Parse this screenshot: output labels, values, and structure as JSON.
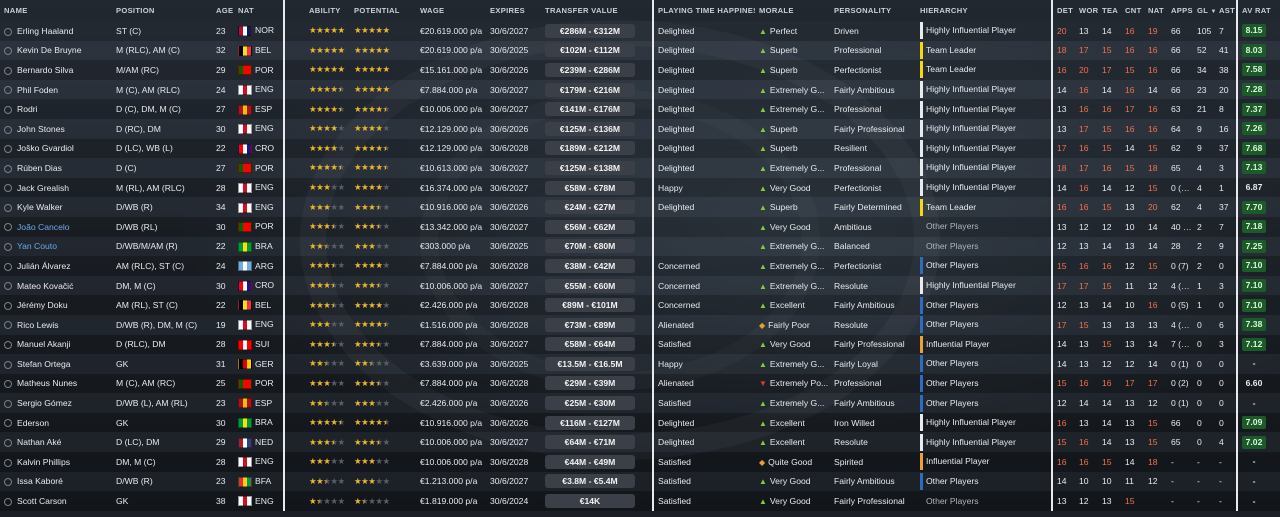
{
  "columns": {
    "name": "NAME",
    "position": "POSITION",
    "age": "AGE",
    "nat": "NAT",
    "ability": "ABILITY",
    "potential": "POTENTIAL",
    "wage": "WAGE",
    "expires": "EXPIRES",
    "transfer_value": "TRANSFER VALUE",
    "playing_time": "PLAYING TIME HAPPINESS",
    "morale": "MORALE",
    "personality": "PERSONALITY",
    "hierarchy": "HIERARCHY",
    "det": "DET",
    "wor": "WOR",
    "tea": "TEA",
    "cnt": "CNT",
    "nat2": "NAT",
    "apps": "APPS",
    "gl": "GL",
    "sort_icon": "▼",
    "ast": "AST",
    "avrat": "AV RAT"
  },
  "colors": {
    "loan_name": "#6aa8e8",
    "star": "#e9b72f",
    "hot_attr": "#f07050",
    "rating_green": "#1d5a2a"
  },
  "players": [
    {
      "name": "Erling Haaland",
      "pos": "ST (C)",
      "age": "23",
      "nat": "NOR",
      "flag": [
        "#ba0c2f",
        "#ffffff",
        "#00205b"
      ],
      "ability": 5,
      "potential": 5,
      "wage": "€20.619.000 p/a",
      "expires": "30/6/2027",
      "value": "€286M - €312M",
      "pt": "Delighted",
      "morale": "Perfect",
      "mood": "up",
      "pers": "Driven",
      "hier": "Highly Influential Player",
      "hcol": "#e8eaee",
      "det": "20",
      "wor": "13",
      "tea": "14",
      "cnt": "16",
      "nat2": "19",
      "apps": "66",
      "gl": "105",
      "ast": "7",
      "rat": "8.15",
      "rgreen": true,
      "hot": [
        1,
        0,
        0,
        1,
        1
      ]
    },
    {
      "name": "Kevin De Bruyne",
      "pos": "M (RLC), AM (C)",
      "age": "32",
      "nat": "BEL",
      "flag": [
        "#000000",
        "#fdda24",
        "#ef3340"
      ],
      "ability": 5,
      "potential": 5,
      "wage": "€20.619.000 p/a",
      "expires": "30/6/2025",
      "value": "€102M - €112M",
      "pt": "Delighted",
      "morale": "Superb",
      "mood": "up",
      "pers": "Professional",
      "hier": "Team Leader",
      "hcol": "#f5d90a",
      "det": "18",
      "wor": "17",
      "tea": "15",
      "cnt": "16",
      "nat2": "16",
      "apps": "66",
      "gl": "52",
      "ast": "41",
      "rat": "8.03",
      "rgreen": true,
      "hot": [
        1,
        1,
        1,
        1,
        1
      ]
    },
    {
      "name": "Bernardo Silva",
      "pos": "M/AM (RC)",
      "age": "29",
      "nat": "POR",
      "flag": [
        "#006600",
        "#ff0000",
        "#ff0000"
      ],
      "ability": 5,
      "potential": 5,
      "wage": "€15.161.000 p/a",
      "expires": "30/6/2026",
      "value": "€239M - €286M",
      "pt": "Delighted",
      "morale": "Superb",
      "mood": "up",
      "pers": "Perfectionist",
      "hier": "Team Leader",
      "hcol": "#f5d90a",
      "det": "16",
      "wor": "20",
      "tea": "17",
      "cnt": "15",
      "nat2": "16",
      "apps": "66",
      "gl": "34",
      "ast": "38",
      "rat": "7.58",
      "rgreen": true,
      "hot": [
        1,
        1,
        1,
        1,
        1
      ]
    },
    {
      "name": "Phil Foden",
      "pos": "M (C), AM (RLC)",
      "age": "24",
      "nat": "ENG",
      "flag": [
        "#ffffff",
        "#ce1124",
        "#ffffff"
      ],
      "ability": 4.5,
      "potential": 5,
      "wage": "€7.884.000 p/a",
      "expires": "30/6/2027",
      "value": "€179M - €216M",
      "pt": "Delighted",
      "morale": "Extremely G...",
      "mood": "up",
      "pers": "Fairly Ambitious",
      "hier": "Highly Influential Player",
      "hcol": "#e8eaee",
      "det": "14",
      "wor": "16",
      "tea": "14",
      "cnt": "16",
      "nat2": "14",
      "apps": "66",
      "gl": "23",
      "ast": "20",
      "rat": "7.28",
      "rgreen": true,
      "hot": [
        0,
        1,
        0,
        1,
        0
      ]
    },
    {
      "name": "Rodri",
      "pos": "D (C), DM, M (C)",
      "age": "27",
      "nat": "ESP",
      "flag": [
        "#aa151b",
        "#f1bf00",
        "#aa151b"
      ],
      "ability": 4.5,
      "potential": 4.5,
      "wage": "€10.006.000 p/a",
      "expires": "30/6/2027",
      "value": "€141M - €176M",
      "pt": "Delighted",
      "morale": "Extremely G...",
      "mood": "up",
      "pers": "Professional",
      "hier": "Highly Influential Player",
      "hcol": "#e8eaee",
      "det": "13",
      "wor": "16",
      "tea": "16",
      "cnt": "17",
      "nat2": "16",
      "apps": "63",
      "gl": "21",
      "ast": "8",
      "rat": "7.37",
      "rgreen": true,
      "hot": [
        0,
        1,
        1,
        1,
        1
      ]
    },
    {
      "name": "John Stones",
      "pos": "D (RC), DM",
      "age": "30",
      "nat": "ENG",
      "flag": [
        "#ffffff",
        "#ce1124",
        "#ffffff"
      ],
      "ability": 4,
      "potential": 4,
      "wage": "€12.129.000 p/a",
      "expires": "30/6/2026",
      "value": "€125M - €136M",
      "pt": "Delighted",
      "morale": "Superb",
      "mood": "up",
      "pers": "Fairly Professional",
      "hier": "Highly Influential Player",
      "hcol": "#e8eaee",
      "det": "13",
      "wor": "17",
      "tea": "15",
      "cnt": "16",
      "nat2": "16",
      "apps": "64",
      "gl": "9",
      "ast": "16",
      "rat": "7.26",
      "rgreen": true,
      "hot": [
        0,
        1,
        1,
        1,
        1
      ]
    },
    {
      "name": "Joško Gvardiol",
      "pos": "D (LC), WB (L)",
      "age": "22",
      "nat": "CRO",
      "flag": [
        "#ff0000",
        "#ffffff",
        "#171796"
      ],
      "ability": 4,
      "potential": 4.5,
      "wage": "€12.129.000 p/a",
      "expires": "30/6/2028",
      "value": "€189M - €212M",
      "pt": "Delighted",
      "morale": "Superb",
      "mood": "up",
      "pers": "Resilient",
      "hier": "Highly Influential Player",
      "hcol": "#e8eaee",
      "det": "17",
      "wor": "16",
      "tea": "15",
      "cnt": "14",
      "nat2": "15",
      "apps": "62",
      "gl": "9",
      "ast": "37",
      "rat": "7.68",
      "rgreen": true,
      "hot": [
        1,
        1,
        1,
        0,
        1
      ]
    },
    {
      "name": "Rúben Dias",
      "pos": "D (C)",
      "age": "27",
      "nat": "POR",
      "flag": [
        "#006600",
        "#ff0000",
        "#ff0000"
      ],
      "ability": 4.5,
      "potential": 4.5,
      "wage": "€10.613.000 p/a",
      "expires": "30/6/2027",
      "value": "€125M - €138M",
      "pt": "Delighted",
      "morale": "Extremely G...",
      "mood": "up",
      "pers": "Professional",
      "hier": "Highly Influential Player",
      "hcol": "#e8eaee",
      "det": "18",
      "wor": "17",
      "tea": "16",
      "cnt": "15",
      "nat2": "18",
      "apps": "65",
      "gl": "4",
      "ast": "3",
      "rat": "7.13",
      "rgreen": true,
      "hot": [
        1,
        1,
        1,
        1,
        1
      ]
    },
    {
      "name": "Jack Grealish",
      "pos": "M (RL), AM (RLC)",
      "age": "28",
      "nat": "ENG",
      "flag": [
        "#ffffff",
        "#ce1124",
        "#ffffff"
      ],
      "ability": 3,
      "potential": 4,
      "wage": "€16.374.000 p/a",
      "expires": "30/6/2027",
      "value": "€58M - €78M",
      "pt": "Happy",
      "morale": "Very Good",
      "mood": "up",
      "pers": "Perfectionist",
      "hier": "Highly Influential Player",
      "hcol": "#e8eaee",
      "det": "14",
      "wor": "16",
      "tea": "14",
      "cnt": "12",
      "nat2": "15",
      "apps": "0 (54)",
      "gl": "4",
      "ast": "1",
      "rat": "6.87",
      "rgreen": false,
      "hot": [
        0,
        1,
        0,
        0,
        1
      ]
    },
    {
      "name": "Kyle Walker",
      "pos": "D/WB (R)",
      "age": "34",
      "nat": "ENG",
      "flag": [
        "#ffffff",
        "#ce1124",
        "#ffffff"
      ],
      "ability": 3,
      "potential": 3.5,
      "wage": "€10.916.000 p/a",
      "expires": "30/6/2026",
      "value": "€24M - €27M",
      "pt": "Delighted",
      "morale": "Superb",
      "mood": "up",
      "pers": "Fairly Determined",
      "hier": "Team Leader",
      "hcol": "#f5d90a",
      "det": "16",
      "wor": "16",
      "tea": "15",
      "cnt": "13",
      "nat2": "20",
      "apps": "62",
      "gl": "4",
      "ast": "37",
      "rat": "7.70",
      "rgreen": true,
      "hot": [
        1,
        1,
        1,
        0,
        1
      ]
    },
    {
      "name": "João Cancelo",
      "pos": "D/WB (RL)",
      "age": "30",
      "nat": "POR",
      "flag": [
        "#006600",
        "#ff0000",
        "#ff0000"
      ],
      "ability": 3.5,
      "potential": 3.5,
      "wage": "€13.342.000 p/a",
      "expires": "30/6/2027",
      "value": "€56M - €62M",
      "pt": "",
      "morale": "Very Good",
      "mood": "up",
      "pers": "Ambitious",
      "hier": "Other Players",
      "hcol": "",
      "det": "13",
      "wor": "12",
      "tea": "12",
      "cnt": "10",
      "nat2": "14",
      "apps": "40 (1)",
      "gl": "2",
      "ast": "7",
      "rat": "7.18",
      "rgreen": true,
      "hot": [
        0,
        0,
        0,
        0,
        0
      ],
      "loan": true
    },
    {
      "name": "Yan Couto",
      "pos": "D/WB/M/AM (R)",
      "age": "22",
      "nat": "BRA",
      "flag": [
        "#009c3b",
        "#ffdf00",
        "#009c3b"
      ],
      "ability": 2.5,
      "potential": 3,
      "wage": "€303.000 p/a",
      "expires": "30/6/2025",
      "value": "€70M - €80M",
      "pt": "",
      "morale": "Extremely G...",
      "mood": "up",
      "pers": "Balanced",
      "hier": "Other Players",
      "hcol": "",
      "det": "12",
      "wor": "13",
      "tea": "14",
      "cnt": "13",
      "nat2": "14",
      "apps": "28",
      "gl": "2",
      "ast": "9",
      "rat": "7.25",
      "rgreen": true,
      "hot": [
        0,
        0,
        0,
        0,
        0
      ],
      "loan": true
    },
    {
      "name": "Julián Álvarez",
      "pos": "AM (RLC), ST (C)",
      "age": "24",
      "nat": "ARG",
      "flag": [
        "#74acdf",
        "#ffffff",
        "#74acdf"
      ],
      "ability": 3.5,
      "potential": 4,
      "wage": "€7.884.000 p/a",
      "expires": "30/6/2028",
      "value": "€38M - €42M",
      "pt": "Concerned",
      "morale": "Extremely G...",
      "mood": "up",
      "pers": "Perfectionist",
      "hier": "Other Players",
      "hcol": "#2f6cc0",
      "det": "15",
      "wor": "16",
      "tea": "16",
      "cnt": "12",
      "nat2": "15",
      "apps": "0 (7)",
      "gl": "2",
      "ast": "0",
      "rat": "7.10",
      "rgreen": true,
      "hot": [
        1,
        1,
        1,
        0,
        1
      ]
    },
    {
      "name": "Mateo Kovačić",
      "pos": "DM, M (C)",
      "age": "30",
      "nat": "CRO",
      "flag": [
        "#ff0000",
        "#ffffff",
        "#171796"
      ],
      "ability": 3.5,
      "potential": 3.5,
      "wage": "€10.006.000 p/a",
      "expires": "30/6/2027",
      "value": "€55M - €60M",
      "pt": "Concerned",
      "morale": "Extremely G...",
      "mood": "up",
      "pers": "Resolute",
      "hier": "Highly Influential Player",
      "hcol": "#e8eaee",
      "det": "17",
      "wor": "17",
      "tea": "15",
      "cnt": "11",
      "nat2": "12",
      "apps": "4 (33)",
      "gl": "1",
      "ast": "3",
      "rat": "7.10",
      "rgreen": true,
      "hot": [
        1,
        1,
        1,
        0,
        0
      ]
    },
    {
      "name": "Jérémy Doku",
      "pos": "AM (RL), ST (C)",
      "age": "22",
      "nat": "BEL",
      "flag": [
        "#000000",
        "#fdda24",
        "#ef3340"
      ],
      "ability": 3.5,
      "potential": 4,
      "wage": "€2.426.000 p/a",
      "expires": "30/6/2028",
      "value": "€89M - €101M",
      "pt": "Concerned",
      "morale": "Excellent",
      "mood": "up",
      "pers": "Fairly Ambitious",
      "hier": "Other Players",
      "hcol": "#2f6cc0",
      "det": "12",
      "wor": "13",
      "tea": "14",
      "cnt": "10",
      "nat2": "16",
      "apps": "0 (5)",
      "gl": "1",
      "ast": "0",
      "rat": "7.10",
      "rgreen": true,
      "hot": [
        0,
        0,
        0,
        0,
        1
      ]
    },
    {
      "name": "Rico Lewis",
      "pos": "D/WB (R), DM, M (C)",
      "age": "19",
      "nat": "ENG",
      "flag": [
        "#ffffff",
        "#ce1124",
        "#ffffff"
      ],
      "ability": 3,
      "potential": 4.5,
      "wage": "€1.516.000 p/a",
      "expires": "30/6/2028",
      "value": "€73M - €89M",
      "pt": "Alienated",
      "morale": "Fairly Poor",
      "mood": "side",
      "pers": "Resolute",
      "hier": "Other Players",
      "hcol": "#2f6cc0",
      "det": "17",
      "wor": "15",
      "tea": "13",
      "cnt": "13",
      "nat2": "13",
      "apps": "4 (18)",
      "gl": "0",
      "ast": "6",
      "rat": "7.38",
      "rgreen": true,
      "hot": [
        1,
        1,
        0,
        0,
        0
      ]
    },
    {
      "name": "Manuel Akanji",
      "pos": "D (RLC), DM",
      "age": "28",
      "nat": "SUI",
      "flag": [
        "#ff0000",
        "#ffffff",
        "#ff0000"
      ],
      "ability": 3.5,
      "potential": 3.5,
      "wage": "€7.884.000 p/a",
      "expires": "30/6/2027",
      "value": "€58M - €64M",
      "pt": "Satisfied",
      "morale": "Very Good",
      "mood": "up",
      "pers": "Fairly Professional",
      "hier": "Influential Player",
      "hcol": "#f0a030",
      "det": "14",
      "wor": "13",
      "tea": "15",
      "cnt": "13",
      "nat2": "14",
      "apps": "7 (39)",
      "gl": "0",
      "ast": "3",
      "rat": "7.12",
      "rgreen": true,
      "hot": [
        0,
        0,
        1,
        0,
        0
      ]
    },
    {
      "name": "Stefan Ortega",
      "pos": "GK",
      "age": "31",
      "nat": "GER",
      "flag": [
        "#000000",
        "#dd0000",
        "#ffce00"
      ],
      "ability": 2.5,
      "potential": 2.5,
      "wage": "€3.639.000 p/a",
      "expires": "30/6/2025",
      "value": "€13.5M - €16.5M",
      "pt": "Happy",
      "morale": "Extremely G...",
      "mood": "up",
      "pers": "Fairly Loyal",
      "hier": "Other Players",
      "hcol": "#2f6cc0",
      "det": "14",
      "wor": "13",
      "tea": "12",
      "cnt": "12",
      "nat2": "14",
      "apps": "0 (1)",
      "gl": "0",
      "ast": "0",
      "rat": "-",
      "rgreen": false,
      "hot": [
        0,
        0,
        0,
        0,
        0
      ]
    },
    {
      "name": "Matheus Nunes",
      "pos": "M (C), AM (RC)",
      "age": "25",
      "nat": "POR",
      "flag": [
        "#006600",
        "#ff0000",
        "#ff0000"
      ],
      "ability": 3,
      "potential": 3.5,
      "wage": "€7.884.000 p/a",
      "expires": "30/6/2028",
      "value": "€29M - €39M",
      "pt": "Alienated",
      "morale": "Extremely Po...",
      "mood": "down",
      "pers": "Professional",
      "hier": "Other Players",
      "hcol": "#2f6cc0",
      "det": "15",
      "wor": "16",
      "tea": "16",
      "cnt": "17",
      "nat2": "17",
      "apps": "0 (2)",
      "gl": "0",
      "ast": "0",
      "rat": "6.60",
      "rgreen": false,
      "hot": [
        1,
        1,
        1,
        1,
        1
      ]
    },
    {
      "name": "Sergio Gómez",
      "pos": "D/WB (L), AM (RL)",
      "age": "23",
      "nat": "ESP",
      "flag": [
        "#aa151b",
        "#f1bf00",
        "#aa151b"
      ],
      "ability": 2.5,
      "potential": 3,
      "wage": "€2.426.000 p/a",
      "expires": "30/6/2026",
      "value": "€25M - €30M",
      "pt": "Satisfied",
      "morale": "Extremely G...",
      "mood": "up",
      "pers": "Fairly Ambitious",
      "hier": "Other Players",
      "hcol": "#2f6cc0",
      "det": "12",
      "wor": "14",
      "tea": "14",
      "cnt": "13",
      "nat2": "12",
      "apps": "0 (1)",
      "gl": "0",
      "ast": "0",
      "rat": "-",
      "rgreen": false,
      "hot": [
        0,
        0,
        0,
        0,
        0
      ]
    },
    {
      "name": "Ederson",
      "pos": "GK",
      "age": "30",
      "nat": "BRA",
      "flag": [
        "#009c3b",
        "#ffdf00",
        "#009c3b"
      ],
      "ability": 4.5,
      "potential": 4.5,
      "wage": "€10.916.000 p/a",
      "expires": "30/6/2026",
      "value": "€116M - €127M",
      "pt": "Delighted",
      "morale": "Excellent",
      "mood": "up",
      "pers": "Iron Willed",
      "hier": "Highly Influential Player",
      "hcol": "#e8eaee",
      "det": "16",
      "wor": "13",
      "tea": "14",
      "cnt": "13",
      "nat2": "15",
      "apps": "66",
      "gl": "0",
      "ast": "0",
      "rat": "7.09",
      "rgreen": true,
      "hot": [
        1,
        0,
        0,
        0,
        1
      ]
    },
    {
      "name": "Nathan Aké",
      "pos": "D (LC), DM",
      "age": "29",
      "nat": "NED",
      "flag": [
        "#ae1c28",
        "#ffffff",
        "#21468b"
      ],
      "ability": 3.5,
      "potential": 3.5,
      "wage": "€10.006.000 p/a",
      "expires": "30/6/2027",
      "value": "€64M - €71M",
      "pt": "Delighted",
      "morale": "Excellent",
      "mood": "up",
      "pers": "Resolute",
      "hier": "Highly Influential Player",
      "hcol": "#e8eaee",
      "det": "15",
      "wor": "16",
      "tea": "14",
      "cnt": "13",
      "nat2": "15",
      "apps": "65",
      "gl": "0",
      "ast": "4",
      "rat": "7.02",
      "rgreen": true,
      "hot": [
        1,
        1,
        0,
        0,
        1
      ]
    },
    {
      "name": "Kalvin Phillips",
      "pos": "DM, M (C)",
      "age": "28",
      "nat": "ENG",
      "flag": [
        "#ffffff",
        "#ce1124",
        "#ffffff"
      ],
      "ability": 3,
      "potential": 3,
      "wage": "€10.006.000 p/a",
      "expires": "30/6/2028",
      "value": "€44M - €49M",
      "pt": "Satisfied",
      "morale": "Quite Good",
      "mood": "side",
      "pers": "Spirited",
      "hier": "Influential Player",
      "hcol": "#f0a030",
      "det": "16",
      "wor": "16",
      "tea": "15",
      "cnt": "14",
      "nat2": "18",
      "apps": "-",
      "gl": "-",
      "ast": "-",
      "rat": "-",
      "rgreen": false,
      "hot": [
        1,
        1,
        1,
        0,
        1
      ]
    },
    {
      "name": "Issa Kaboré",
      "pos": "D/WB (R)",
      "age": "23",
      "nat": "BFA",
      "flag": [
        "#ef2b2d",
        "#fcd116",
        "#009e49"
      ],
      "ability": 2.5,
      "potential": 3,
      "wage": "€1.213.000 p/a",
      "expires": "30/6/2027",
      "value": "€3.8M - €5.4M",
      "pt": "Satisfied",
      "morale": "Very Good",
      "mood": "up",
      "pers": "Fairly Ambitious",
      "hier": "Other Players",
      "hcol": "#2f6cc0",
      "det": "14",
      "wor": "10",
      "tea": "10",
      "cnt": "11",
      "nat2": "12",
      "apps": "-",
      "gl": "-",
      "ast": "-",
      "rat": "-",
      "rgreen": false,
      "hot": [
        0,
        0,
        0,
        0,
        0
      ]
    },
    {
      "name": "Scott Carson",
      "pos": "GK",
      "age": "38",
      "nat": "ENG",
      "flag": [
        "#ffffff",
        "#ce1124",
        "#ffffff"
      ],
      "ability": 1.5,
      "potential": 1.5,
      "wage": "€1.819.000 p/a",
      "expires": "30/6/2024",
      "value": "€14K",
      "pt": "Satisfied",
      "morale": "Very Good",
      "mood": "up",
      "pers": "Fairly Professional",
      "hier": "Other Players",
      "hcol": "",
      "det": "13",
      "wor": "12",
      "tea": "13",
      "cnt": "15",
      "nat2": "",
      "apps": "-",
      "gl": "-",
      "ast": "-",
      "rat": "-",
      "rgreen": false,
      "hot": [
        0,
        0,
        0,
        1,
        0
      ]
    }
  ]
}
